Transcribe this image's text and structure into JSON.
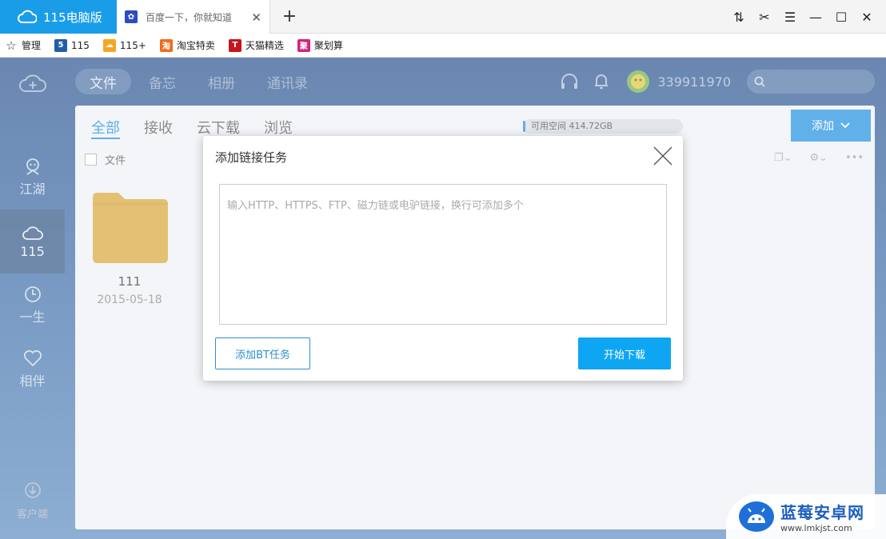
{
  "browser": {
    "brand": "115电脑版",
    "tab_title": "百度一下，你就知道",
    "tab_close": "✕",
    "new_tab": "+",
    "window_controls": [
      "⇅",
      "✂",
      "☰",
      "—",
      "☐",
      "✕"
    ]
  },
  "bookmarks": [
    {
      "label": "管理",
      "icon": "star-icon"
    },
    {
      "label": "115",
      "icon": "115-logo-icon"
    },
    {
      "label": "115+",
      "icon": "115plus-icon"
    },
    {
      "label": "淘宝特卖",
      "icon": "taobao-icon"
    },
    {
      "label": "天猫精选",
      "icon": "tmall-icon"
    },
    {
      "label": "聚划算",
      "icon": "juhuasuan-icon"
    }
  ],
  "sidebar": {
    "items": [
      {
        "label": "江湖",
        "icon": "jianghu-icon"
      },
      {
        "label": "115",
        "icon": "cloud-icon"
      },
      {
        "label": "一生",
        "icon": "clock-icon"
      },
      {
        "label": "相伴",
        "icon": "heart-icon"
      }
    ],
    "client": "客户端"
  },
  "topnav": {
    "tabs": [
      "文件",
      "备忘",
      "相册",
      "通讯录"
    ],
    "username": "339911970",
    "search_placeholder": ""
  },
  "panel": {
    "tabs": [
      "全部",
      "接收",
      "云下载",
      "浏览"
    ],
    "space": "可用空间 414.72GB",
    "add_button": "添加",
    "list_header": "文件",
    "folder": {
      "name": "111",
      "date": "2015-05-18"
    }
  },
  "modal": {
    "title": "添加链接任务",
    "placeholder": "输入HTTP、HTTPS、FTP、磁力链或电驴链接，换行可添加多个",
    "bt_button": "添加BT任务",
    "start_button": "开始下载"
  },
  "watermark": {
    "title": "蓝莓安卓网",
    "url": "www.lmkjst.com"
  }
}
